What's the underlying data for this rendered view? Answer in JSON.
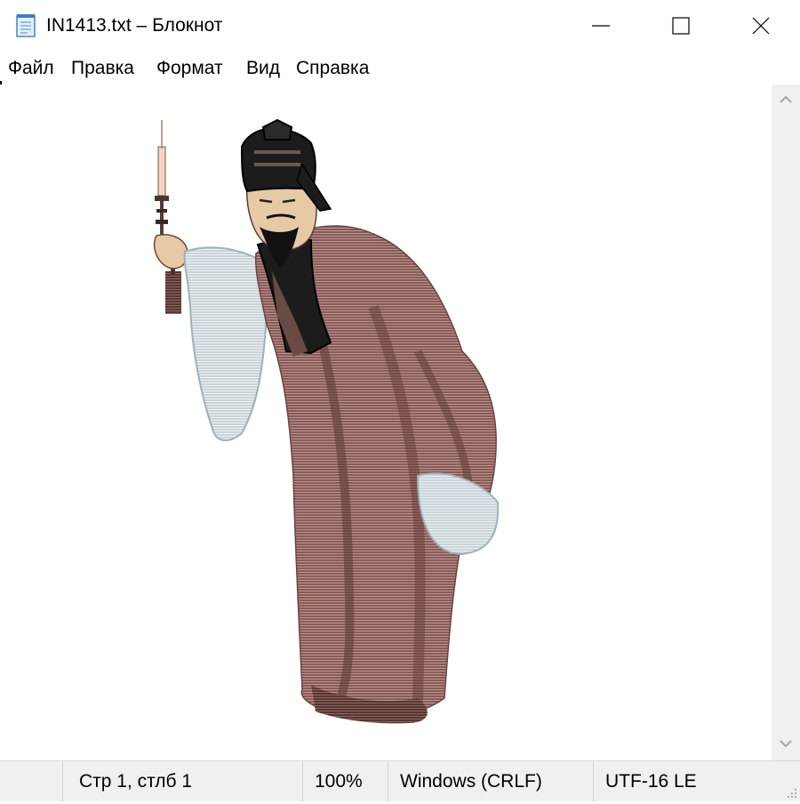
{
  "window": {
    "title": "IN1413.txt – Блокнот",
    "icons": {
      "app": "notepad-icon",
      "minimize": "minimize-icon",
      "maximize": "maximize-icon",
      "close": "close-icon"
    }
  },
  "menu": {
    "items": [
      "Файл",
      "Правка",
      "Формат",
      "Вид",
      "Справка"
    ]
  },
  "editor": {
    "content_description_icon": "ascii-art-chinese-scholar-figure"
  },
  "scrollbar": {
    "up_icon": "chevron-up-icon",
    "down_icon": "chevron-down-icon"
  },
  "status": {
    "position": "Стр 1, стлб 1",
    "zoom": "100%",
    "line_endings": "Windows (CRLF)",
    "encoding": "UTF-16 LE",
    "grip_icon": "resize-grip-icon"
  },
  "colors": {
    "robe": "#8a5a56",
    "robe_dark": "#5a3632",
    "sleeve": "#c9d3d8",
    "hat": "#1c1c1c",
    "skin": "#e8c9a6",
    "chrome": "#f0f0f0"
  }
}
